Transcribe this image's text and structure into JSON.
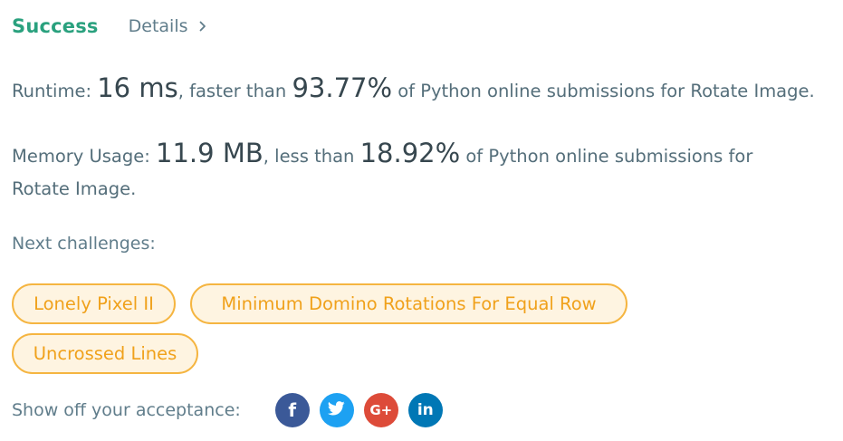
{
  "status": {
    "title": "Success",
    "details_label": "Details"
  },
  "runtime": {
    "label": "Runtime: ",
    "value": "16 ms",
    "middle": ", faster than ",
    "percent": "93.77%",
    "suffix": " of Python online submissions for Rotate Image."
  },
  "memory": {
    "label": "Memory Usage: ",
    "value": "11.9 MB",
    "middle": ", less than ",
    "percent": "18.92%",
    "suffix": " of Python online submissions for Rotate Image."
  },
  "next": {
    "label": "Next challenges:",
    "items": [
      {
        "label": "Lonely Pixel II"
      },
      {
        "label": "Minimum Domino Rotations For Equal Row"
      },
      {
        "label": "Uncrossed Lines"
      }
    ]
  },
  "share": {
    "label": "Show off your acceptance:",
    "buttons": [
      {
        "icon": "facebook-icon",
        "glyph": "f",
        "color": "#3b5998"
      },
      {
        "icon": "twitter-icon",
        "glyph": "",
        "color": "#1da1f2"
      },
      {
        "icon": "google-plus-icon",
        "glyph": "G+",
        "color": "#dd4b39"
      },
      {
        "icon": "linkedin-icon",
        "glyph": "in",
        "color": "#0077b5"
      }
    ]
  },
  "colors": {
    "success": "#2aa17e",
    "chip_border": "#f5b541",
    "chip_bg": "#fef4e1",
    "chip_text": "#f0a11b",
    "text": "#546e7a"
  }
}
